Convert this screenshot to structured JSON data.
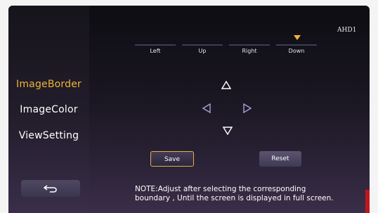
{
  "source": {
    "label": "AHD1"
  },
  "sidebar": {
    "items": [
      {
        "label": "ImageBorder",
        "active": true
      },
      {
        "label": "ImageColor",
        "active": false
      },
      {
        "label": "ViewSetting",
        "active": false
      }
    ],
    "back_icon": "return-arrow-icon"
  },
  "direction_tabs": [
    "Left",
    "Up",
    "Right",
    "Down"
  ],
  "selected_direction": "Down",
  "arrows": [
    "up-arrow-icon",
    "left-arrow-icon",
    "right-arrow-icon",
    "down-arrow-icon"
  ],
  "actions": {
    "save_label": "Save",
    "reset_label": "Reset"
  },
  "note": {
    "line1": "NOTE:Adjust after selecting the corresponding",
    "line2": "boundary , Until the screen is displayed in full screen."
  },
  "colors": {
    "accent": "#f0b43a",
    "text": "#ffffff",
    "button": "#4a4460"
  }
}
